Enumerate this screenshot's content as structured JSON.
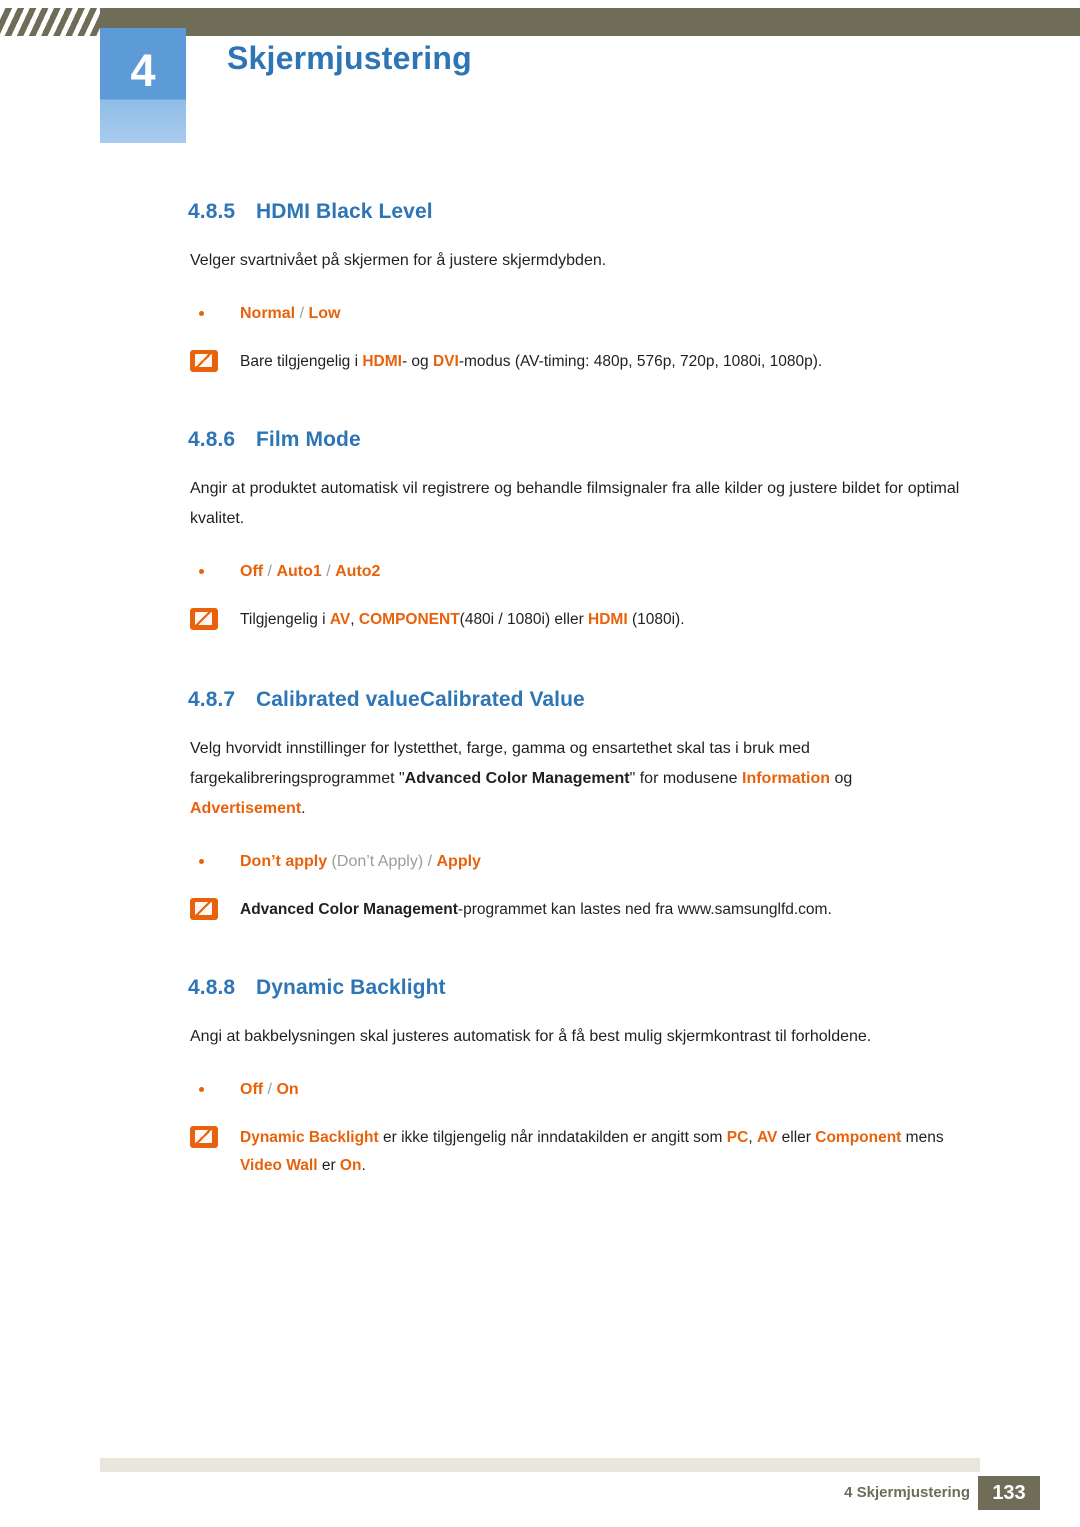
{
  "header": {
    "chapter_number": "4",
    "chapter_title": "Skjermjustering"
  },
  "sections": [
    {
      "number": "4.8.5",
      "title": "HDMI Black Level",
      "paragraph": "Velger svartnivået på skjermen for å justere skjermdybden.",
      "options_plain": "Normal / Low",
      "note_plain": "Bare tilgjengelig i HDMI- og DVI-modus (AV-timing: 480p, 576p, 720p, 1080i, 1080p)."
    },
    {
      "number": "4.8.6",
      "title": "Film Mode",
      "paragraph": "Angir at produktet automatisk vil registrere og behandle filmsignaler fra alle kilder og justere bildet for optimal kvalitet.",
      "options_plain": "Off / Auto1 / Auto2",
      "note_plain": "Tilgjengelig i AV, COMPONENT(480i / 1080i) eller HDMI (1080i)."
    },
    {
      "number": "4.8.7",
      "title": "Calibrated valueCalibrated Value",
      "paragraph": "Velg hvorvidt innstillinger for lystetthet, farge, gamma og ensartethet skal tas i bruk med fargekalibreringsprogrammet \"Advanced Color Management\" for modusene Information og Advertisement.",
      "options_plain": "Don’t apply (Don’t Apply) / Apply",
      "note_plain": "Advanced Color Management-programmet kan lastes ned fra www.samsunglfd.com."
    },
    {
      "number": "4.8.8",
      "title": "Dynamic Backlight",
      "paragraph": "Angi at bakbelysningen skal justeres automatisk for å få best mulig skjermkontrast til forholdene.",
      "options_plain": "Off / On",
      "note_plain": "Dynamic Backlight er ikke tilgjengelig når inndatakilden er angitt som PC, AV eller Component mens Video Wall er On."
    }
  ],
  "section_parts": {
    "s5": {
      "opt_a": "Normal",
      "opt_sep1": " / ",
      "opt_b": "Low",
      "note_pre": "Bare tilgjengelig i ",
      "note_hdmi": "HDMI",
      "note_mid": "- og ",
      "note_dvi": "DVI",
      "note_post": "-modus (AV-timing: 480p, 576p, 720p, 1080i, 1080p)."
    },
    "s6": {
      "opt_a": "Off",
      "opt_sep1": " / ",
      "opt_b": "Auto1",
      "opt_sep2": " / ",
      "opt_c": "Auto2",
      "note_pre": "Tilgjengelig i ",
      "note_av": "AV",
      "note_comma": ", ",
      "note_component": "COMPONENT",
      "note_mid": "(480i / 1080i) eller ",
      "note_hdmi": "HDMI",
      "note_post": " (1080i)."
    },
    "s7": {
      "para_pre": "Velg hvorvidt innstillinger for lystetthet, farge, gamma og ensartethet skal tas i bruk med fargekalibreringsprogrammet \"",
      "para_acm": "Advanced Color Management",
      "para_mid": "\" for modusene ",
      "para_information": "Information",
      "para_og": " og ",
      "para_advertisement": "Advertisement",
      "para_end": ".",
      "opt_a": "Don’t apply",
      "opt_paren": " (Don’t Apply)",
      "opt_sep": " / ",
      "opt_b": "Apply",
      "note_acm": "Advanced Color Management",
      "note_post": "-programmet kan lastes ned fra www.samsunglfd.com."
    },
    "s8": {
      "opt_a": "Off",
      "opt_sep": " / ",
      "opt_b": "On",
      "note_dyn": "Dynamic Backlight",
      "note_mid": " er ikke tilgjengelig når inndatakilden er angitt som ",
      "note_pc": "PC",
      "note_c1": ", ",
      "note_av": "AV",
      "note_eller": " eller ",
      "note_component": "Component",
      "note_mens": " mens ",
      "note_videowall": "Video Wall",
      "note_er": " er ",
      "note_on": "On",
      "note_end": "."
    }
  },
  "footer": {
    "label": "4 Skjermjustering",
    "page": "133"
  }
}
